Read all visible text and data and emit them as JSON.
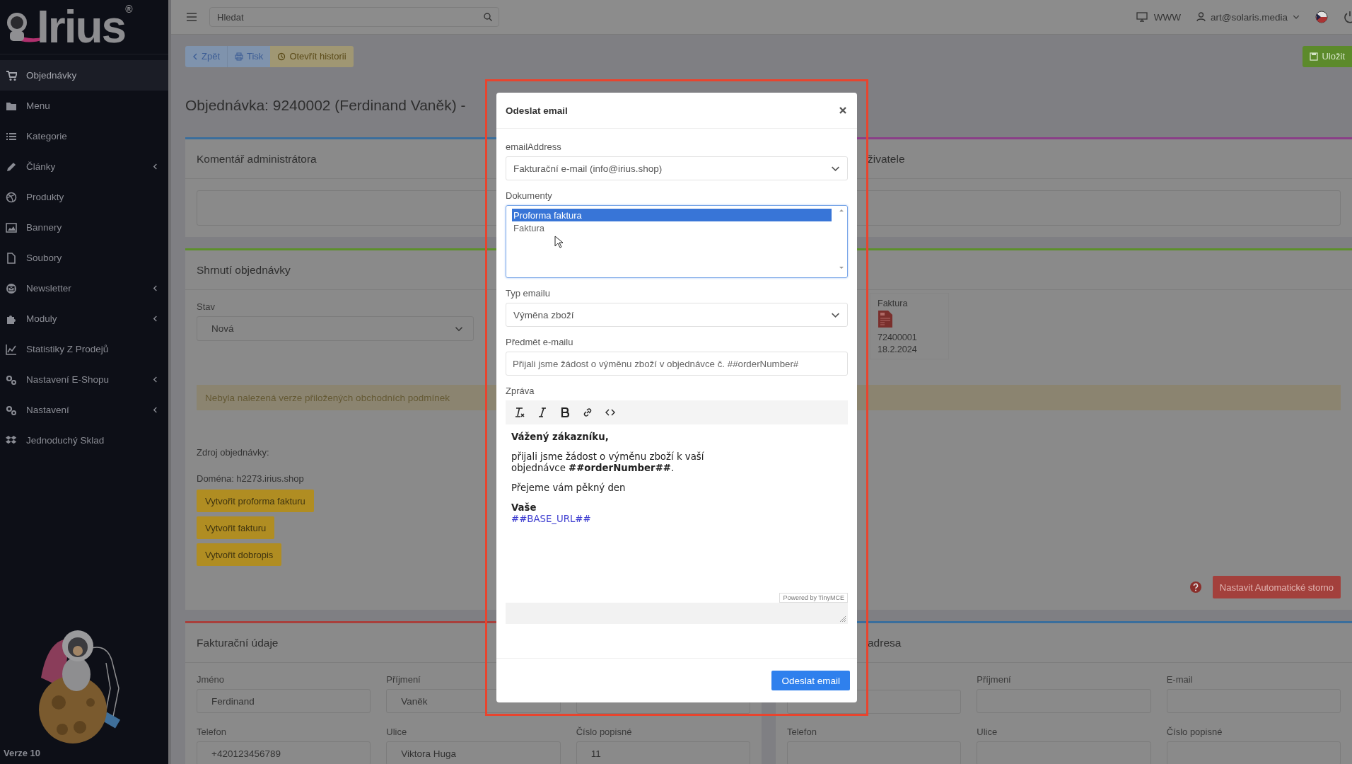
{
  "sidebar": {
    "logo": {
      "text": "Irius",
      "mark": "®"
    },
    "items": [
      {
        "label": "Objednávky",
        "selected": true,
        "has_submenu": false
      },
      {
        "label": "Menu",
        "selected": false,
        "has_submenu": false
      },
      {
        "label": "Kategorie",
        "selected": false,
        "has_submenu": false
      },
      {
        "label": "Články",
        "selected": false,
        "has_submenu": true
      },
      {
        "label": "Produkty",
        "selected": false,
        "has_submenu": false
      },
      {
        "label": "Bannery",
        "selected": false,
        "has_submenu": false
      },
      {
        "label": "Soubory",
        "selected": false,
        "has_submenu": false
      },
      {
        "label": "Newsletter",
        "selected": false,
        "has_submenu": true
      },
      {
        "label": "Moduly",
        "selected": false,
        "has_submenu": true
      },
      {
        "label": "Statistiky Z Prodejů",
        "selected": false,
        "has_submenu": false
      },
      {
        "label": "Nastavení E-Shopu",
        "selected": false,
        "has_submenu": true
      },
      {
        "label": "Nastavení",
        "selected": false,
        "has_submenu": true
      },
      {
        "label": "Jednoduchý Sklad",
        "selected": false,
        "has_submenu": false
      }
    ],
    "version": "Verze 10"
  },
  "topbar": {
    "search": {
      "placeholder": "Hledat"
    },
    "site_link": "WWW",
    "user": "art@solaris.media"
  },
  "toolbar": {
    "buttons": [
      {
        "label": "Zpět",
        "kind": "back"
      },
      {
        "label": "Tisk",
        "kind": "print"
      },
      {
        "label": "Otevřít historii",
        "kind": "history"
      }
    ],
    "save": "Uložit"
  },
  "title": "Objednávka: 9240002 (Ferdinand Vaněk) -",
  "admin_comment": {
    "title": "Komentář administrátora"
  },
  "user_comment": {
    "title": "živatele"
  },
  "summary": {
    "title": "Shrnutí objednávky",
    "status_label": "Stav",
    "status_value": "Nová",
    "documents": [
      {
        "label": "Faktura",
        "number": "72400001",
        "date": "18.2.2024"
      }
    ],
    "alert": "Nebyla nalezená verze přiložených obchodních podmínek",
    "source": "Zdroj objednávky:",
    "domain": "Doména: h2273.irius.shop",
    "actions": [
      "Vytvořit proforma fakturu",
      "Vytvořit fakturu",
      "Vytvořit dobropis"
    ],
    "storno": "Nastavit Automatické storno"
  },
  "billing": {
    "title": "Fakturační údaje",
    "rows": [
      [
        {
          "label": "Jméno",
          "value": "Ferdinand"
        },
        {
          "label": "Příjmení",
          "value": "Vaněk"
        }
      ],
      [
        {
          "label": "Telefon",
          "value": "+420123456789"
        },
        {
          "label": "Ulice",
          "value": "Viktora Huga"
        },
        {
          "label": "Číslo popisné",
          "value": "11"
        }
      ]
    ]
  },
  "delivery": {
    "title": "adresa",
    "rows": [
      [
        "",
        {
          "label": "Příjmení"
        },
        {
          "label": "E-mail"
        }
      ],
      [
        {
          "label": "Telefon"
        },
        {
          "label": "Ulice"
        },
        {
          "label": "Číslo popisné"
        }
      ]
    ]
  },
  "dialog": {
    "title": "Odeslat email",
    "email_address": {
      "label": "emailAddress",
      "value": "Fakturační e-mail (info@irius.shop)"
    },
    "documents": {
      "label": "Dokumenty",
      "options": [
        {
          "label": "Proforma faktura",
          "selected": true
        },
        {
          "label": "Faktura",
          "selected": false
        }
      ]
    },
    "email_type": {
      "label": "Typ emailu",
      "value": "Výměna zboží"
    },
    "subject": {
      "label": "Předmět e-mailu",
      "value": "Přijali jsme žádost o výměnu zboží v objednávce č. ##orderNumber#"
    },
    "message": {
      "label": "Zpráva",
      "greeting": "Vážený zákazníku,",
      "paragraphs": [
        "přijali jsme žádost o výměnu zboží k vaší objednávce **##orderNumber##**.",
        "Přejeme vám pěkný den"
      ],
      "signature": "Vaše",
      "link": "##BASE_URL##",
      "branding": "Powered by TinyMCE"
    },
    "submit": "Odeslat email"
  }
}
